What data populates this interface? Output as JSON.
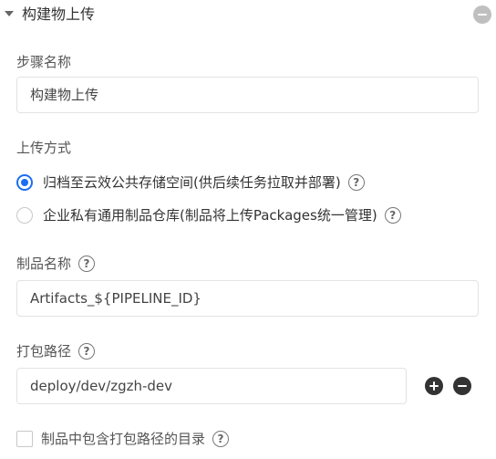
{
  "section": {
    "title": "构建物上传",
    "icons": {
      "expand": "caret-down-icon",
      "collapse": "minus-circle-icon"
    }
  },
  "step_name": {
    "label": "步骤名称",
    "value": "构建物上传"
  },
  "upload_method": {
    "label": "上传方式",
    "options": [
      {
        "label": "归档至云效公共存储空间(供后续任务拉取并部署)",
        "selected": true
      },
      {
        "label": "企业私有通用制品仓库(制品将上传Packages统一管理)",
        "selected": false
      }
    ]
  },
  "artifact_name": {
    "label": "制品名称",
    "value": "Artifacts_${PIPELINE_ID}"
  },
  "package_path": {
    "label": "打包路径",
    "value": "deploy/dev/zgzh-dev"
  },
  "include_path_dir": {
    "label": "制品中包含打包路径的目录",
    "checked": false
  },
  "help_glyph": "?",
  "colors": {
    "accent": "#1b6ef3",
    "label_text": "#555555",
    "input_border": "#e3e3e3",
    "action_button": "#333333",
    "collapse_button": "#bfbfbf"
  }
}
